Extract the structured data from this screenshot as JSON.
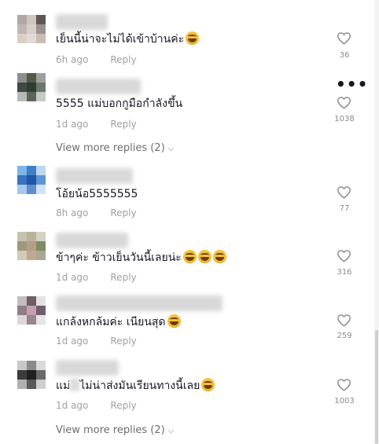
{
  "comments": [
    {
      "text": "เย็นนี้น่าจะไม่ได้เข้าบ้านค่ะ",
      "emoji_count": 1,
      "time": "6h ago",
      "reply_label": "Reply",
      "likes": "36",
      "avatar_colors": [
        "#b1a8a4",
        "#cdc6c1",
        "#5e5753",
        "#c2b7b0",
        "#d8cfca",
        "#9c938e",
        "#d8cfc9",
        "#e4dbd6",
        "#c9bdb5"
      ]
    },
    {
      "text": "5555 แม่บอกกูมือกำลังขึ้น",
      "emoji_count": 0,
      "time": "1d ago",
      "reply_label": "Reply",
      "likes": "1038",
      "avatar_colors": [
        "#8c8f8d",
        "#54594e",
        "#9aa39b",
        "#3f4a43",
        "#2f3d31",
        "#6d776d",
        "#b5bab6",
        "#5d6558",
        "#c6cbc6"
      ]
    },
    {
      "text": "โอ้ยน้อ5555555",
      "emoji_count": 0,
      "time": "8h ago",
      "reply_label": "Reply",
      "likes": "77",
      "avatar_colors": [
        "#7db6e8",
        "#3f7fc7",
        "#bcd9f1",
        "#3a72bd",
        "#1d57a6",
        "#5f95d1",
        "#a5c8ea",
        "#5c8fcc",
        "#cfe3f4"
      ]
    },
    {
      "text": "ข้าๆค่ะ ข้าวเย็นวันนี้เลยน่ะ",
      "emoji_count": 3,
      "time": "1d ago",
      "reply_label": "Reply",
      "likes": "316",
      "avatar_colors": [
        "#c7c3ae",
        "#b8b49a",
        "#d5d2c2",
        "#9c9a7c",
        "#b69e86",
        "#7c8d64",
        "#d0ccb8",
        "#c1a78f",
        "#a8a893"
      ]
    },
    {
      "text": "แกล้งหกล้มค่ะ เนียนสุด",
      "emoji_count": 1,
      "time": "1d ago",
      "reply_label": "Reply",
      "likes": "259",
      "avatar_colors": [
        "#c3bdc0",
        "#6c5f66",
        "#e6e1e3",
        "#8f7d87",
        "#c49fb0",
        "#6f5f6c",
        "#ded7da",
        "#97858f",
        "#e8e3e6"
      ]
    },
    {
      "text_before": "แม่",
      "text_after": "ไม่น่าส่งมันเรียนทางนี้เลย",
      "emoji_count": 1,
      "time": "1d ago",
      "reply_label": "Reply",
      "likes": "1003",
      "avatar_colors": [
        "#c9c9c9",
        "#8a8a8a",
        "#dadada",
        "#3c3c3c",
        "#1f1f1f",
        "#6a6a6a",
        "#b0b0b0",
        "#5a5a5a",
        "#cfcfcf"
      ]
    }
  ],
  "view_more_label": "View more replies (2)",
  "more_options_glyph": "•••"
}
